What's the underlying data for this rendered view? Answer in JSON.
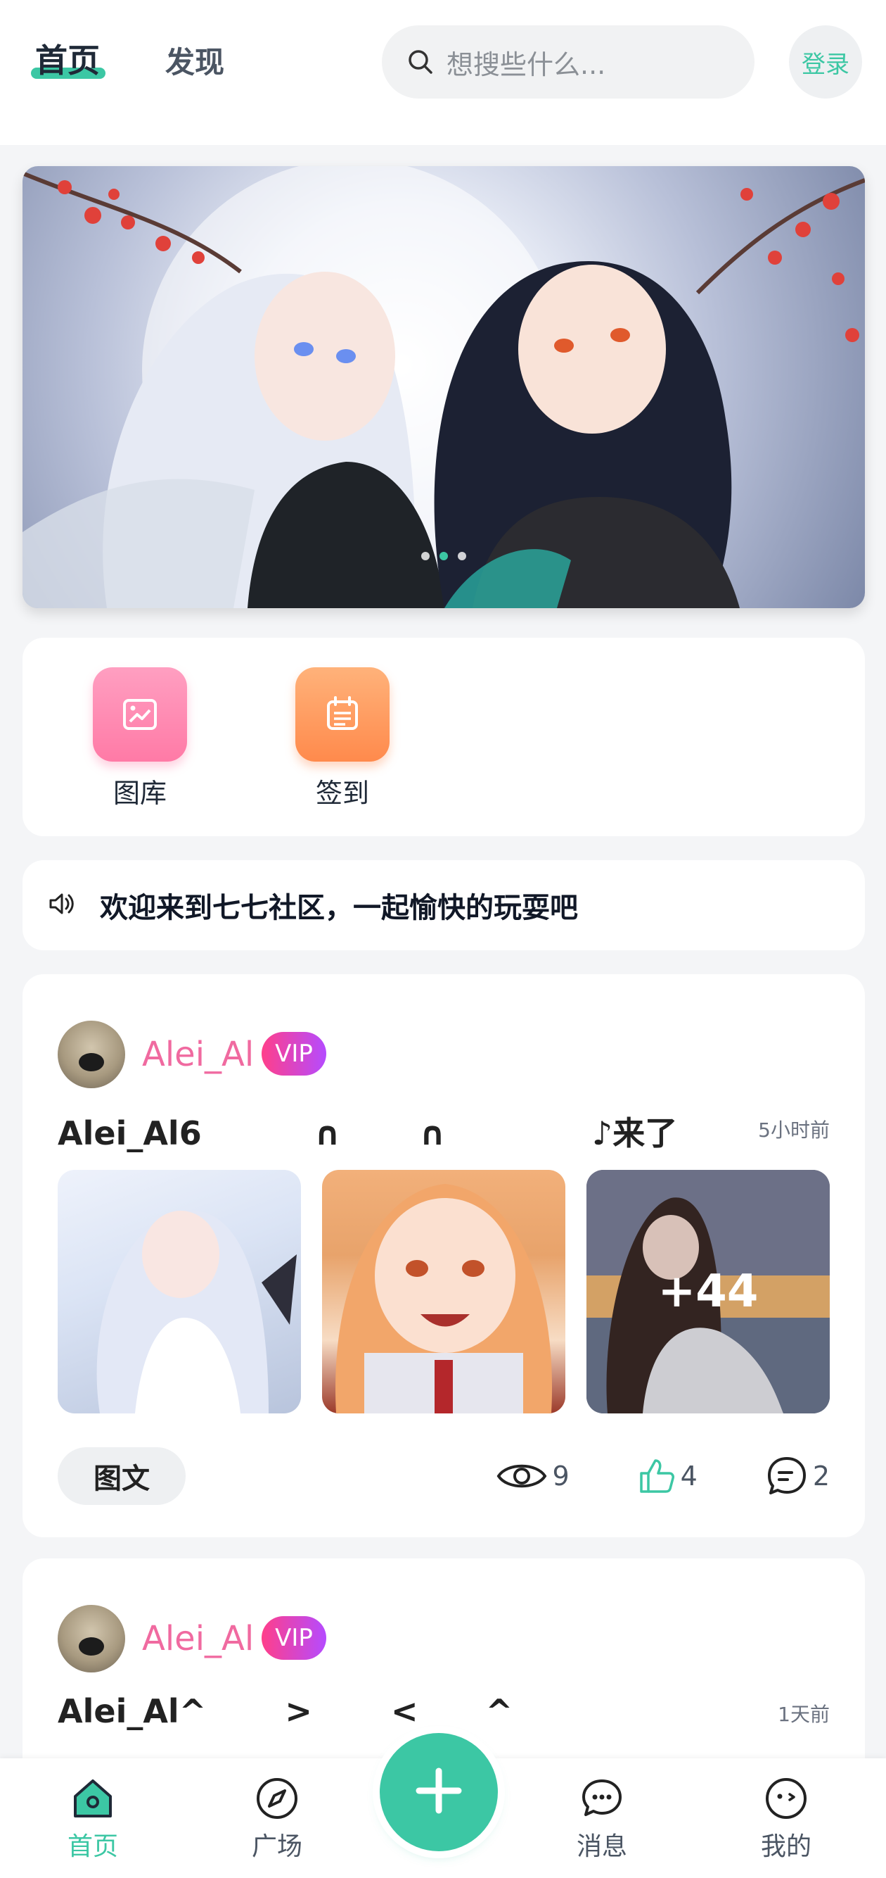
{
  "header": {
    "tabs": [
      {
        "label": "首页",
        "active": true
      },
      {
        "label": "发现",
        "active": false
      }
    ],
    "search_placeholder": "想搜些什么...",
    "login_label": "登录",
    "accent_color": "#3cc7a4"
  },
  "banner": {
    "slides_count": 3,
    "active_index": 1
  },
  "quick_actions": [
    {
      "label": "图库",
      "icon": "image-icon",
      "color": "#ff8ab2"
    },
    {
      "label": "签到",
      "icon": "calendar-icon",
      "color": "#ff9a5c"
    }
  ],
  "notice": {
    "icon": "speaker-icon",
    "text": "欢迎来到七七社区，一起愉快的玩耍吧"
  },
  "posts": [
    {
      "username": "Alei_Al",
      "badge": "VIP",
      "title": "Alei_Al6          ∩       ∩             ♪来了",
      "time": "5小时前",
      "more_images": "+44",
      "tag": "图文",
      "views": "9",
      "likes": "4",
      "comments": "2"
    },
    {
      "username": "Alei_Al",
      "badge": "VIP",
      "title": "Alei_Al^       >       <      ^",
      "time": "1天前"
    }
  ],
  "bottom_nav": [
    {
      "label": "首页",
      "icon": "home-icon",
      "active": true
    },
    {
      "label": "广场",
      "icon": "compass-icon",
      "active": false
    },
    {
      "label": "消息",
      "icon": "chat-icon",
      "active": false
    },
    {
      "label": "我的",
      "icon": "face-icon",
      "active": false
    }
  ],
  "fab": {
    "icon": "plus-icon"
  }
}
